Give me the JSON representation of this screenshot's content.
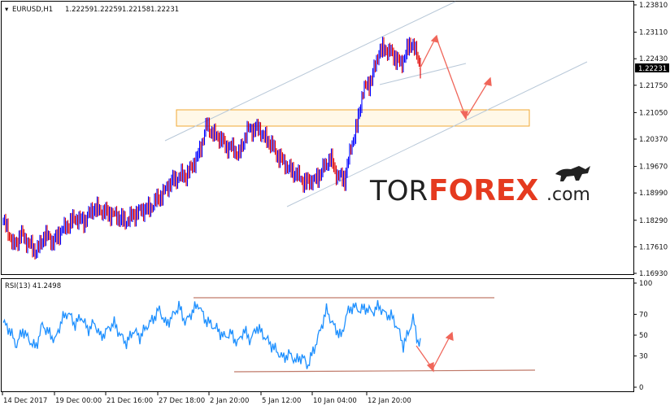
{
  "chart_data": [
    {
      "type": "candlestick",
      "symbol_header": "EURUSD,H1",
      "ohlc_header": [
        "1.22259",
        "1.22259",
        "1.22158",
        "1.22231"
      ],
      "last_price_label": "1.22231",
      "y_ticks": [
        "1.23810",
        "1.23110",
        "1.22430",
        "1.21750",
        "1.21050",
        "1.20370",
        "1.19670",
        "1.18990",
        "1.18290",
        "1.17610",
        "1.16930"
      ],
      "ylim": [
        1.1693,
        1.2381
      ],
      "x_ticks": [
        "14 Dec 2017",
        "19 Dec 00:00",
        "21 Dec 16:00",
        "27 Dec 18:00",
        "2 Jan 20:00",
        "5 Jan 12:00",
        "10 Jan 04:00",
        "12 Jan 20:00"
      ],
      "price_path": [
        [
          0,
          1.183
        ],
        [
          12,
          1.1765
        ],
        [
          22,
          1.179
        ],
        [
          32,
          1.177
        ],
        [
          40,
          1.1745
        ],
        [
          50,
          1.179
        ],
        [
          62,
          1.1775
        ],
        [
          75,
          1.181
        ],
        [
          90,
          1.1835
        ],
        [
          100,
          1.1825
        ],
        [
          110,
          1.186
        ],
        [
          125,
          1.185
        ],
        [
          140,
          1.184
        ],
        [
          150,
          1.1825
        ],
        [
          165,
          1.185
        ],
        [
          180,
          1.186
        ],
        [
          195,
          1.1895
        ],
        [
          210,
          1.1935
        ],
        [
          225,
          1.1945
        ],
        [
          238,
          1.1985
        ],
        [
          250,
          1.207
        ],
        [
          262,
          1.2045
        ],
        [
          275,
          1.202
        ],
        [
          290,
          1.2
        ],
        [
          302,
          1.2065
        ],
        [
          315,
          1.206
        ],
        [
          330,
          1.202
        ],
        [
          345,
          1.1975
        ],
        [
          358,
          1.195
        ],
        [
          372,
          1.1925
        ],
        [
          385,
          1.1935
        ],
        [
          395,
          1.1965
        ],
        [
          402,
          1.199
        ],
        [
          410,
          1.1945
        ],
        [
          420,
          1.1935
        ],
        [
          428,
          1.202
        ],
        [
          435,
          1.207
        ],
        [
          442,
          1.216
        ],
        [
          452,
          1.2185
        ],
        [
          462,
          1.226
        ],
        [
          470,
          1.227
        ],
        [
          480,
          1.225
        ],
        [
          490,
          1.223
        ],
        [
          498,
          1.227
        ],
        [
          503,
          1.229
        ],
        [
          508,
          1.225
        ],
        [
          513,
          1.2223
        ]
      ]
    },
    {
      "type": "line",
      "indicator_header": "RSI(13) 41.2498",
      "y_ticks": [
        "100",
        "70",
        "50",
        "30",
        "0"
      ],
      "ylim": [
        0,
        100
      ],
      "rsi_path": [
        [
          0,
          62
        ],
        [
          8,
          55
        ],
        [
          16,
          40
        ],
        [
          24,
          55
        ],
        [
          32,
          45
        ],
        [
          40,
          38
        ],
        [
          48,
          60
        ],
        [
          56,
          52
        ],
        [
          64,
          45
        ],
        [
          72,
          65
        ],
        [
          80,
          72
        ],
        [
          88,
          60
        ],
        [
          96,
          68
        ],
        [
          104,
          55
        ],
        [
          112,
          62
        ],
        [
          120,
          48
        ],
        [
          128,
          55
        ],
        [
          136,
          62
        ],
        [
          144,
          50
        ],
        [
          152,
          42
        ],
        [
          160,
          55
        ],
        [
          168,
          48
        ],
        [
          176,
          58
        ],
        [
          184,
          65
        ],
        [
          192,
          75
        ],
        [
          200,
          60
        ],
        [
          208,
          68
        ],
        [
          216,
          78
        ],
        [
          224,
          62
        ],
        [
          232,
          72
        ],
        [
          240,
          80
        ],
        [
          248,
          65
        ],
        [
          256,
          60
        ],
        [
          264,
          55
        ],
        [
          272,
          48
        ],
        [
          280,
          52
        ],
        [
          288,
          42
        ],
        [
          296,
          55
        ],
        [
          304,
          45
        ],
        [
          312,
          58
        ],
        [
          320,
          50
        ],
        [
          328,
          42
        ],
        [
          336,
          35
        ],
        [
          344,
          28
        ],
        [
          352,
          32
        ],
        [
          360,
          25
        ],
        [
          368,
          30
        ],
        [
          374,
          20
        ],
        [
          380,
          32
        ],
        [
          386,
          45
        ],
        [
          392,
          60
        ],
        [
          398,
          75
        ],
        [
          404,
          62
        ],
        [
          410,
          55
        ],
        [
          416,
          48
        ],
        [
          422,
          70
        ],
        [
          430,
          78
        ],
        [
          438,
          74
        ],
        [
          446,
          76
        ],
        [
          454,
          72
        ],
        [
          462,
          78
        ],
        [
          470,
          70
        ],
        [
          478,
          68
        ],
        [
          486,
          55
        ],
        [
          492,
          40
        ],
        [
          498,
          52
        ],
        [
          504,
          66
        ],
        [
          510,
          44
        ],
        [
          514,
          41
        ]
      ]
    }
  ],
  "watermark": {
    "part1": "TOR",
    "part2": "FOREX",
    "part3": ".com"
  },
  "colors": {
    "bull_candle": "#0000ff",
    "bear_candle": "#e00000",
    "rsi_line": "#1e90ff",
    "channel_line": "#b8c8d8",
    "support_zone": "#f0a020",
    "forecast_arrow": "#f0665a",
    "rsi_level_line": "#c07a6a",
    "logo_accent": "#e53a1f"
  }
}
